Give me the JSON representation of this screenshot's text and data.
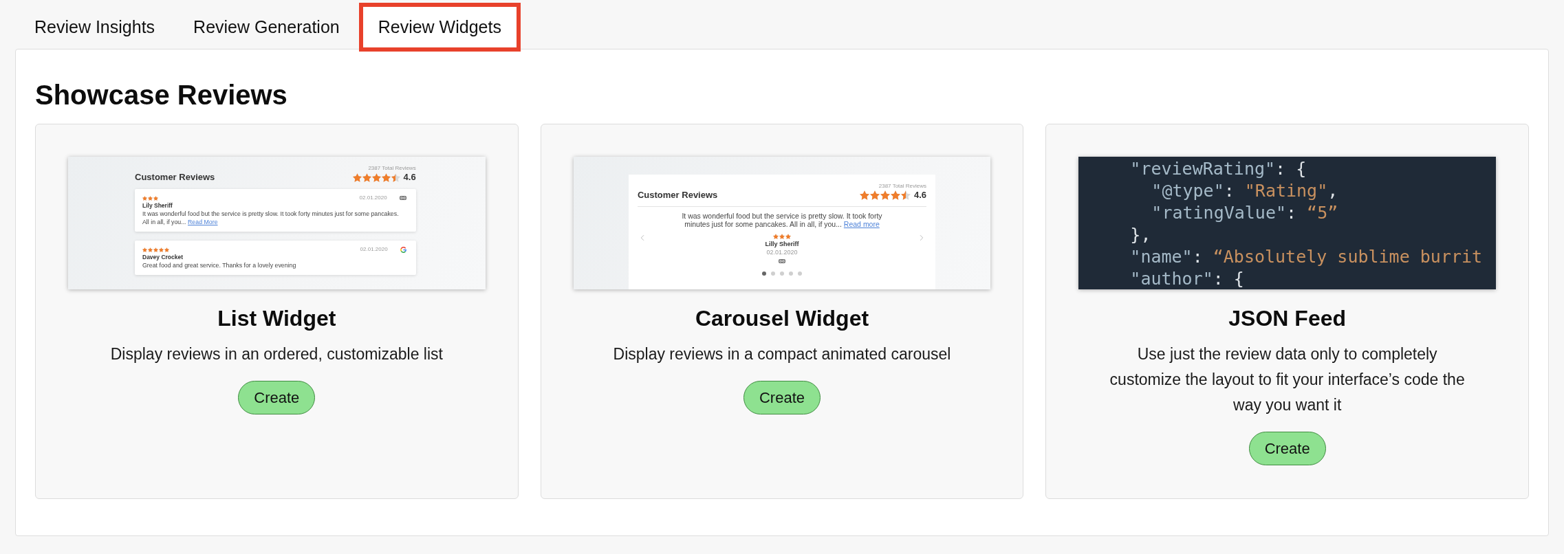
{
  "tabs": [
    {
      "label": "Review Insights",
      "selected": false
    },
    {
      "label": "Review Generation",
      "selected": false
    },
    {
      "label": "Review Widgets",
      "selected": true
    }
  ],
  "section": {
    "title": "Showcase Reviews"
  },
  "widgets": [
    {
      "kind": "list",
      "preview": {
        "heading": "Customer Reviews",
        "total": "2387 Total Reviews",
        "stars": 4.5,
        "rating": "4.6",
        "reviews": [
          {
            "kind": "goggles",
            "stars": 3,
            "date": "02.01.2020",
            "name": "Lily Sheriff",
            "text": "It was wonderful food but the service is pretty slow. It took forty minutes just for some pancakes. All in all, if you...",
            "link": "Read More"
          },
          {
            "kind": "google",
            "stars": 5,
            "date": "02.01.2020",
            "name": "Davey Crocket",
            "text": "Great food and great service. Thanks for a lovely evening"
          }
        ]
      },
      "title": "List Widget",
      "description": "Display reviews in an ordered, customizable list",
      "button": "Create"
    },
    {
      "kind": "carousel",
      "preview": {
        "heading": "Customer Reviews",
        "total": "2387 Total Reviews",
        "stars": 4.5,
        "rating": "4.6",
        "review": {
          "kind": "goggles",
          "text": "It was wonderful food but the service is pretty slow. It took forty minutes just for some pancakes. All in all, if you...",
          "link": "Read more",
          "stars": 3,
          "name": "Lilly Sheriff",
          "date": "02.01.2020"
        },
        "dots": [
          {
            "selected": true
          },
          {
            "selected": false
          },
          {
            "selected": false
          },
          {
            "selected": false
          },
          {
            "selected": false
          }
        ]
      },
      "title": "Carousel Widget",
      "description": "Display reviews in a compact animated carousel",
      "button": "Create"
    },
    {
      "kind": "code",
      "preview": {
        "lines": [
          {
            "tokens": [
              {
                "kind": "key",
                "text": "\"reviewRating\""
              },
              {
                "kind": "punct",
                "text": ": {"
              }
            ],
            "children": [
              {
                "tokens": [
                  {
                    "kind": "key",
                    "text": "\"@type\""
                  },
                  {
                    "kind": "punct",
                    "text": ": "
                  },
                  {
                    "kind": "string",
                    "text": "\"Rating\""
                  },
                  {
                    "kind": "punct",
                    "text": ","
                  }
                ]
              },
              {
                "tokens": [
                  {
                    "kind": "key",
                    "text": "\"ratingValue\""
                  },
                  {
                    "kind": "punct",
                    "text": ": "
                  },
                  {
                    "kind": "string",
                    "text": "“5”"
                  }
                ]
              }
            ]
          },
          {
            "tokens": [
              {
                "kind": "punct",
                "text": "},"
              }
            ]
          },
          {
            "tokens": [
              {
                "kind": "key",
                "text": "\"name\""
              },
              {
                "kind": "punct",
                "text": ": "
              },
              {
                "kind": "string",
                "text": "“Absolutely sublime burrit"
              }
            ]
          },
          {
            "tokens": [
              {
                "kind": "key",
                "text": "\"author\""
              },
              {
                "kind": "punct",
                "text": ": {"
              }
            ]
          }
        ]
      },
      "title": "JSON Feed",
      "description": "Use just the review data only to completely customize the layout to fit your interface’s code the way you want it",
      "button": "Create"
    }
  ]
}
